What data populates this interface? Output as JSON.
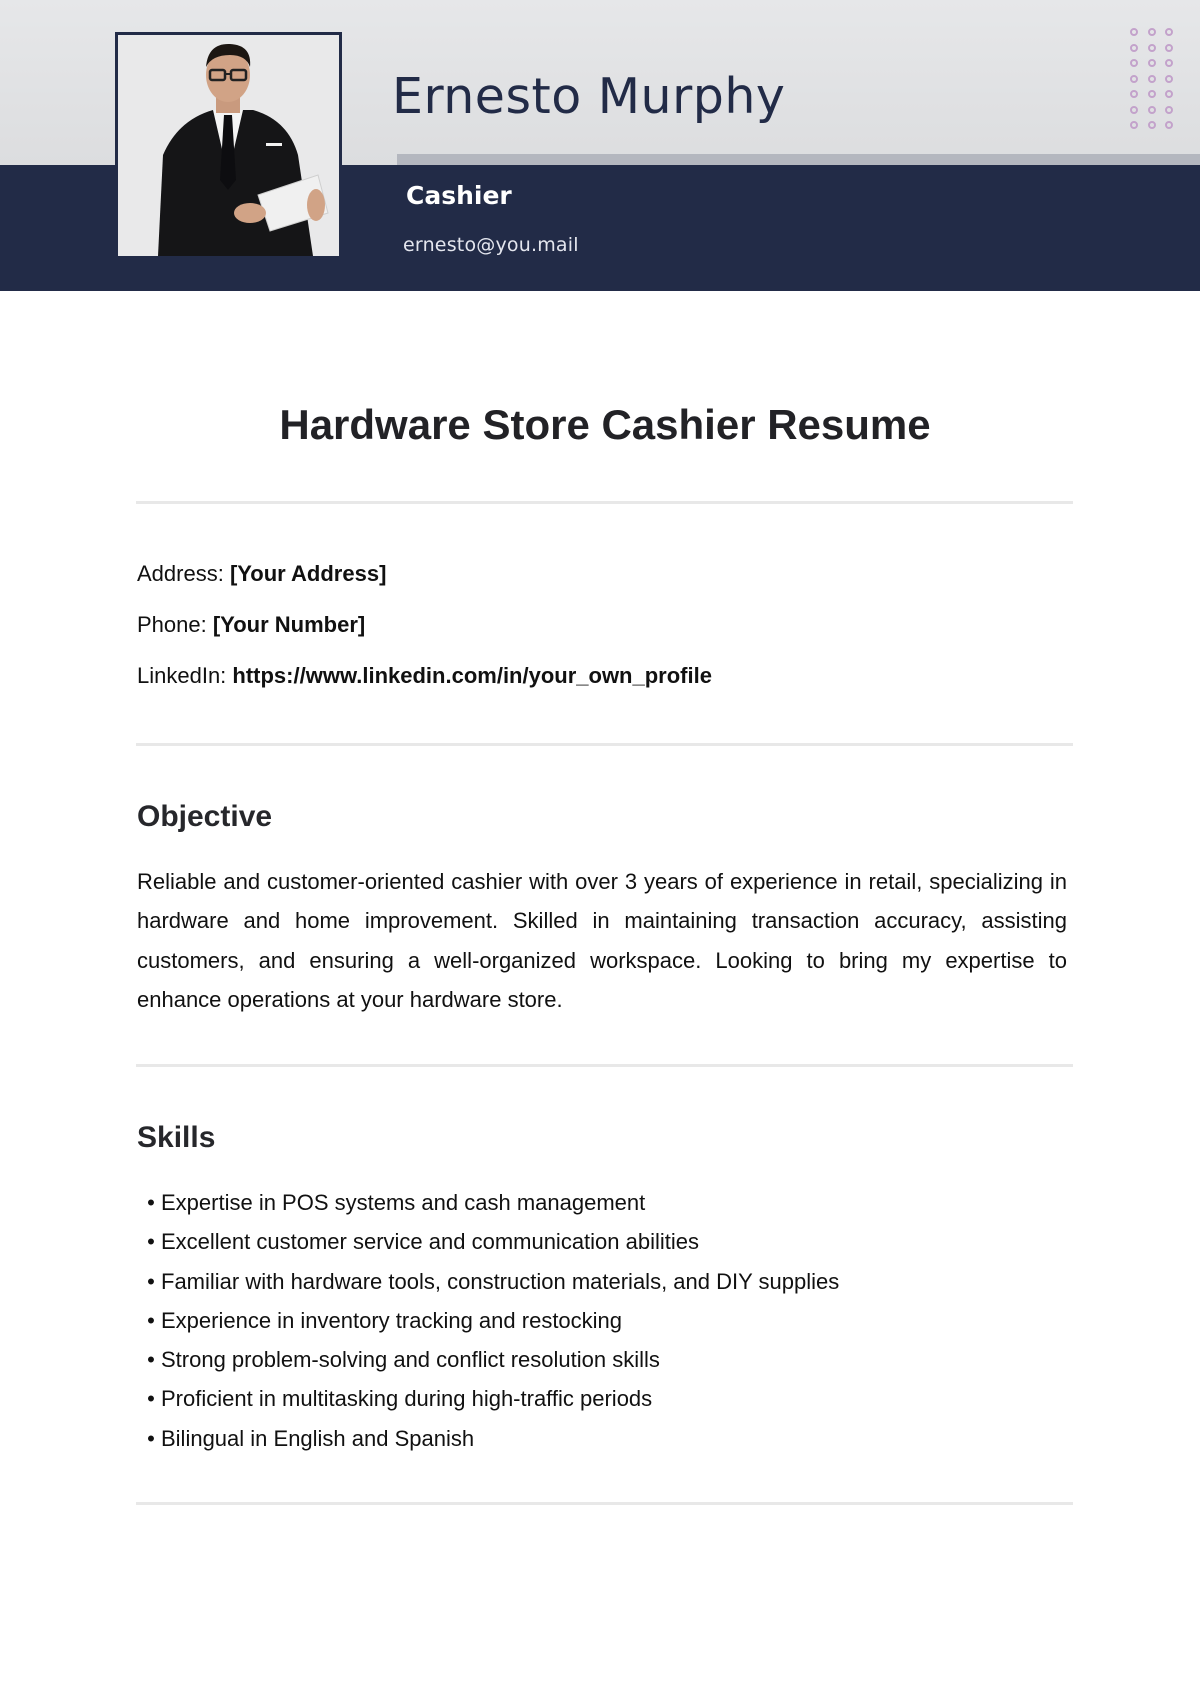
{
  "header": {
    "name": "Ernesto Murphy",
    "role": "Cashier",
    "email": "ernesto@you.mail",
    "photo_alt": "Man in black suit holding a tablet",
    "colors": {
      "navy": "#222b47",
      "light_gray": "#e3e4e6",
      "strip_gray": "#b4b7bf",
      "dot_purple": "#c3a2cb"
    },
    "dot_grid": {
      "rows": 7,
      "cols": 3
    }
  },
  "document": {
    "title": "Hardware Store Cashier Resume"
  },
  "contact": {
    "address_label": "Address:",
    "address_value": "[Your Address]",
    "phone_label": "Phone:",
    "phone_value": "[Your Number]",
    "linkedin_label": "LinkedIn:",
    "linkedin_value": "https://www.linkedin.com/in/your_own_profile"
  },
  "objective": {
    "heading": "Objective",
    "text": "Reliable and customer-oriented cashier with over 3 years of experience in retail, specializing in hardware and home improvement. Skilled in maintaining transaction accuracy, assisting customers, and ensuring a well-organized workspace. Looking to bring my expertise to enhance operations at your hardware store."
  },
  "skills": {
    "heading": "Skills",
    "bullet": "•",
    "items": [
      "Expertise in POS systems and cash management",
      "Excellent customer service and communication abilities",
      "Familiar with hardware tools, construction materials, and DIY supplies",
      "Experience in inventory tracking and restocking",
      "Strong problem-solving and conflict resolution skills",
      "Proficient in multitasking during high-traffic periods",
      "Bilingual in English and Spanish"
    ]
  }
}
